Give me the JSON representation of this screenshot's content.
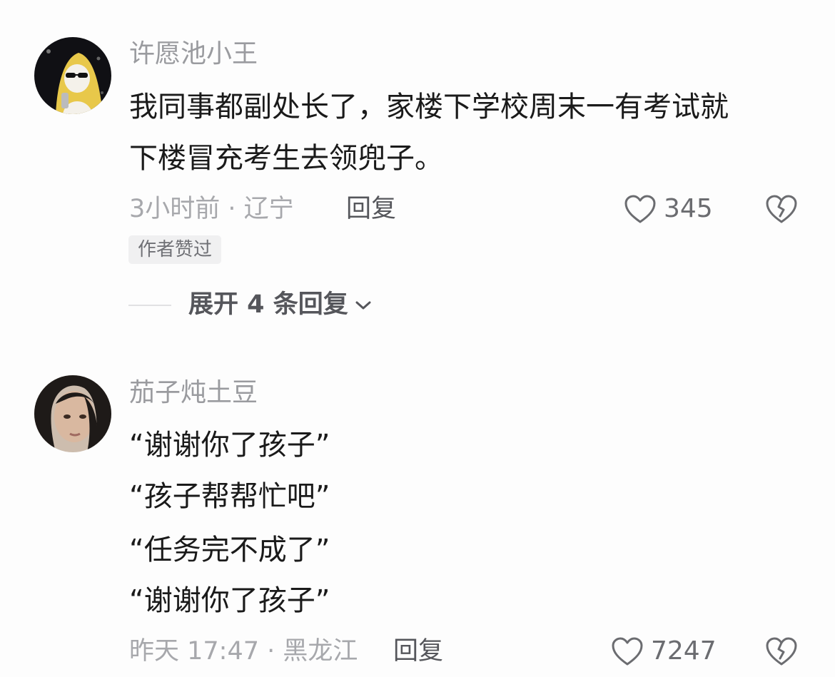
{
  "comments": [
    {
      "username": "许愿池小王",
      "lines": [
        "我同事都副处长了，家楼下学校周末一有考试就",
        "下楼冒充考生去领兜子。"
      ],
      "time_location": "3小时前 · 辽宁",
      "reply_label": "回复",
      "likes": "345",
      "author_badge": "作者赞过",
      "expand_label": "展开 4 条回复"
    },
    {
      "username": "茄子炖土豆",
      "lines": [
        "“谢谢你了孩子”",
        "“孩子帮帮忙吧”",
        "“任务完不成了”",
        "“谢谢你了孩子”"
      ],
      "time_location": "昨天 17:47 · 黑龙江",
      "reply_label": "回复",
      "likes": "7247"
    }
  ],
  "colors": {
    "username": "#9a9b9f",
    "body_text": "#1a1a1a",
    "meta": "#a7a8ac",
    "badge_bg": "#f0f0f1",
    "avatar1_accent": "#e8c84a"
  },
  "icons": [
    "heart-outline-icon",
    "broken-heart-icon",
    "chevron-down-icon"
  ]
}
